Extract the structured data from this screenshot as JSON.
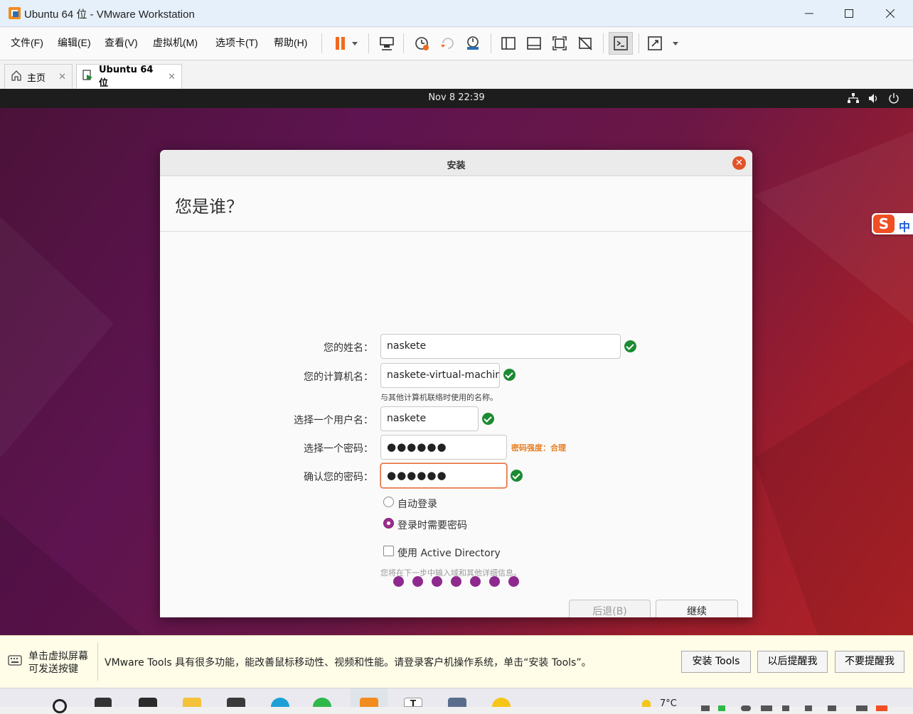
{
  "window": {
    "title": "Ubuntu 64 位 - VMware Workstation"
  },
  "menu": {
    "items": [
      "文件(F)",
      "编辑(E)",
      "查看(V)",
      "虚拟机(M)",
      "选项卡(T)",
      "帮助(H)"
    ]
  },
  "tabs": [
    {
      "label": "主页"
    },
    {
      "label": "Ubuntu 64 位"
    }
  ],
  "guest": {
    "clock": "Nov 8  22:39"
  },
  "dialog": {
    "title": "安装",
    "heading": "您是谁？",
    "fields": {
      "name_label": "您的姓名：",
      "name_value": "naskete",
      "computer_label": "您的计算机名：",
      "computer_value": "naskete-virtual-machin",
      "computer_hint": "与其他计算机联络时使用的名称。",
      "user_label": "选择一个用户名：",
      "user_value": "naskete",
      "password_label": "选择一个密码：",
      "password_value": "●●●●●●",
      "password_strength": "密码强度：合理",
      "confirm_label": "确认您的密码：",
      "confirm_value": "●●●●●●"
    },
    "options": {
      "auto_login": "自动登录",
      "require_password": "登录时需要密码",
      "active_directory": "使用 Active Directory",
      "ad_hint": "您将在下一步中输入域和其他详细信息。"
    },
    "buttons": {
      "back": "后退(B)",
      "continue": "继续"
    }
  },
  "ime": {
    "label": "中"
  },
  "tools_bar": {
    "hint_line1": "单击虚拟屏幕",
    "hint_line2": "可发送按键",
    "message": "VMware Tools 具有很多功能，能改善鼠标移动性、视频和性能。请登录客户机操作系统，单击“安装 Tools”。",
    "install_button": "安装 Tools",
    "remind_later_button": "以后提醒我",
    "never_remind_button": "不要提醒我"
  },
  "taskbar": {
    "temperature": "7°C"
  },
  "colors": {
    "accent_purple": "#8e2a8e",
    "check_green": "#1c8a32",
    "close_orange": "#e3542a",
    "strength_orange": "#e67e22"
  }
}
